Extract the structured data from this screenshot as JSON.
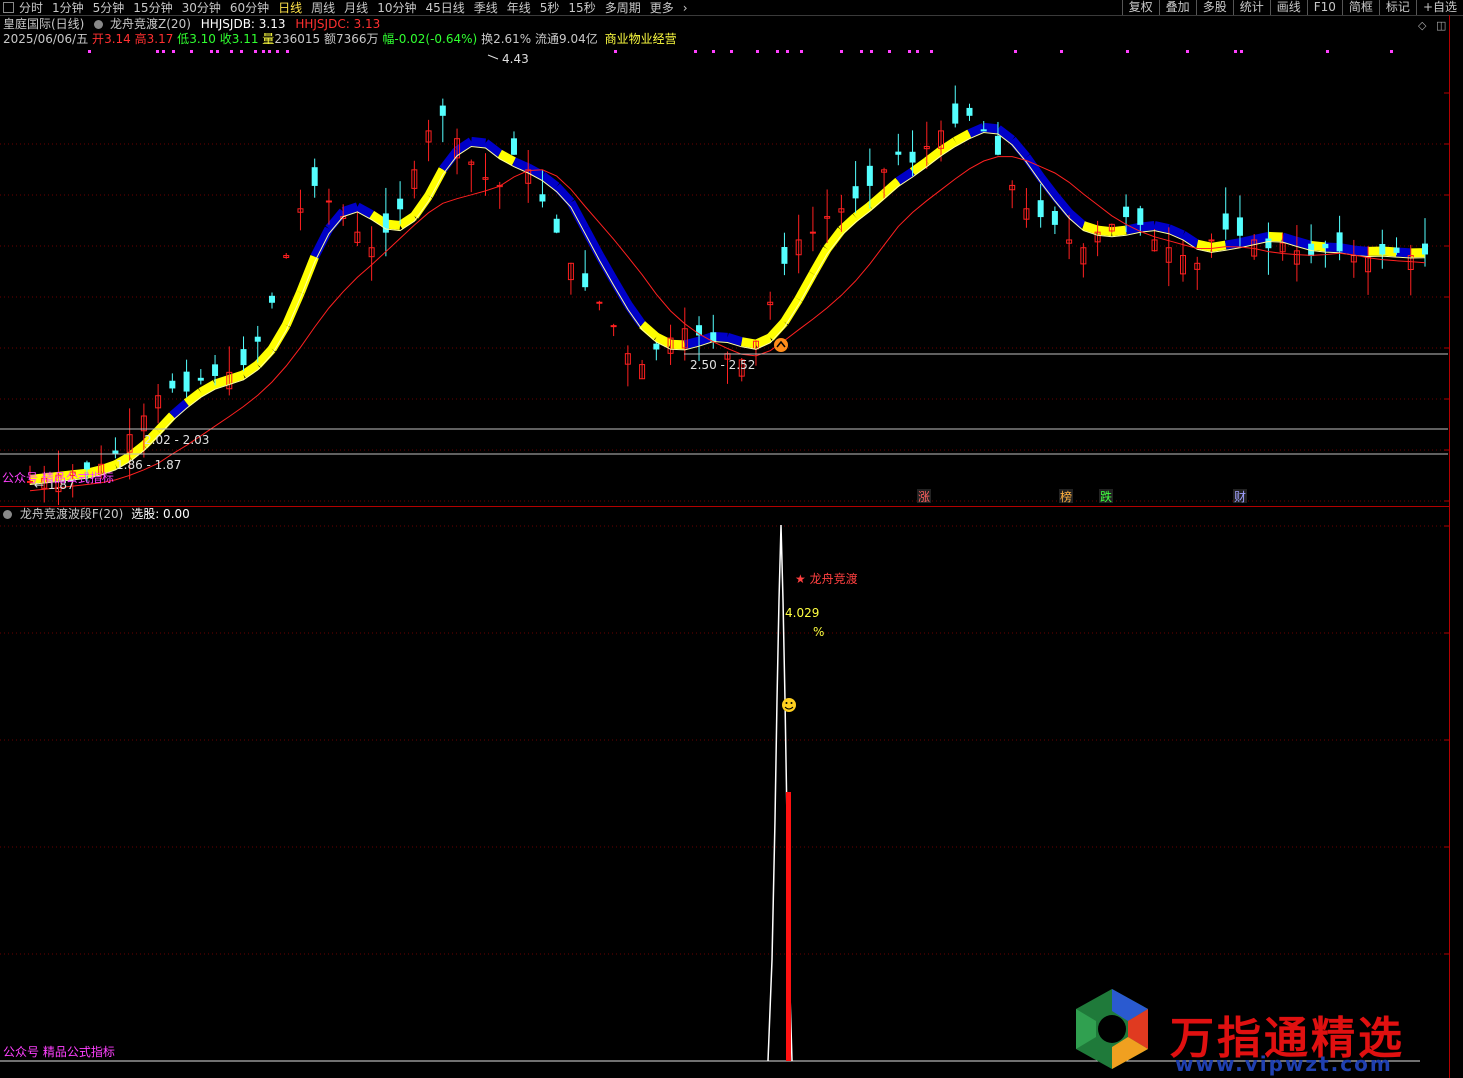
{
  "toolbar": {
    "periods": [
      "分时",
      "1分钟",
      "5分钟",
      "15分钟",
      "30分钟",
      "60分钟",
      "日线",
      "周线",
      "月线",
      "10分钟",
      "45日线",
      "季线",
      "年线",
      "5秒",
      "15秒",
      "多周期",
      "更多"
    ],
    "active_period": "日线",
    "right_buttons": [
      "复权",
      "叠加",
      "多股",
      "统计",
      "画线",
      "F10",
      "简框",
      "标记",
      "+自选"
    ]
  },
  "stock": {
    "name": "皇庭国际(日线)",
    "indicator_name": "龙舟竞渡Z(20)",
    "hhjsjdb_label": "HHJSJDB: 3.13",
    "hhjsjdc_label": "HHJSJDC: 3.13",
    "date": "2025/06/06/五",
    "open_label": "开",
    "open": "3.14",
    "high_label": "高",
    "high": "3.17",
    "low_label": "低",
    "low": "3.10",
    "close_label": "收",
    "close": "3.11",
    "volume_label": "量",
    "volume": "236015",
    "amount_label": "额",
    "amount": "7366万",
    "change_label": "幅",
    "change": "-0.02(-0.64%)",
    "turnover_label": "换",
    "turnover": "2.61%",
    "float_label": "流通",
    "float_value": "9.04亿",
    "sector": "商业物业经营"
  },
  "main_chart": {
    "price_high_marker": "4.43",
    "price_low_marker": "1.87",
    "support_zones": [
      "2.50 - 2.52",
      "2.02 - 2.03",
      "1.86 - 1.87"
    ],
    "bottom_labels": [
      "涨",
      "榜",
      "跌",
      "财"
    ],
    "watermark_left": "公众号 精品公式指标"
  },
  "indicator": {
    "title": "龙舟竞渡波段F(20)",
    "select_label": "选股: 0.00",
    "signal_text": "龙舟竞渡",
    "signal_value": "4.029",
    "signal_unit": "%",
    "watermark_left": "公众号 精品公式指标"
  },
  "watermark": {
    "brand": "万指通精选",
    "url": "www.vipwzt.com"
  },
  "colors": {
    "up": "#ff2020",
    "down": "#54ffff",
    "yellow_band": "#ffff00",
    "blue_band": "#0000c8",
    "ma_fast": "#ffffa0",
    "ma_slow": "#ff2020",
    "support_line": "#c0c0c0",
    "magenta": "#ff40ff",
    "signal_red": "#ff1010"
  },
  "chart_data": {
    "type": "candlestick",
    "trend": [
      1.8,
      1.82,
      1.84,
      1.86,
      1.88,
      1.91,
      1.98,
      2.1,
      2.22,
      2.35,
      2.4,
      2.38,
      2.45,
      2.48,
      2.5,
      2.55,
      2.7,
      2.95,
      3.25,
      3.55,
      3.7,
      3.6,
      3.5,
      3.4,
      3.3,
      3.4,
      3.55,
      3.8,
      4.05,
      4.15,
      4.0,
      3.85,
      3.75,
      3.7,
      3.9,
      3.8,
      3.6,
      3.4,
      3.2,
      3.05,
      2.95,
      2.8,
      2.62,
      2.55,
      2.65,
      2.72,
      2.78,
      2.74,
      2.7,
      2.62,
      2.58,
      2.7,
      2.95,
      3.2,
      3.35,
      3.4,
      3.5,
      3.55,
      3.62,
      3.7,
      3.8,
      3.9,
      3.85,
      3.95,
      4.05,
      4.1,
      4.15,
      4.05,
      3.9,
      3.7,
      3.55,
      3.5,
      3.45,
      3.35,
      3.3,
      3.4,
      3.45,
      3.5,
      3.45,
      3.35,
      3.3,
      3.25,
      3.2,
      3.35,
      3.42,
      3.38,
      3.35,
      3.3,
      3.33,
      3.28,
      3.25,
      3.3,
      3.28,
      3.25,
      3.24,
      3.26,
      3.27,
      3.25,
      3.26
    ]
  }
}
